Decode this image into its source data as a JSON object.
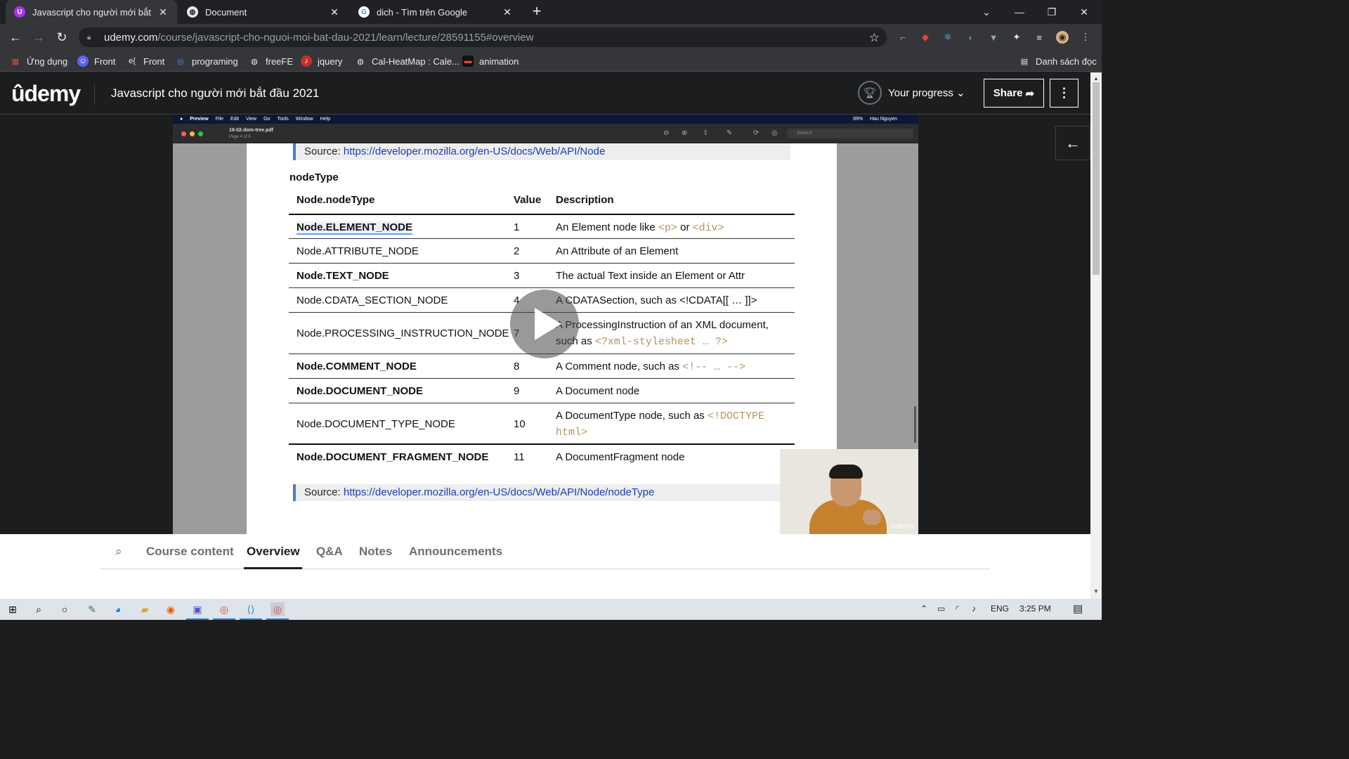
{
  "browser": {
    "tabs": [
      {
        "title": "Javascript cho người mới bắt đầu",
        "favicon_letter": "U",
        "favicon_color": "#a435f0"
      },
      {
        "title": "Document",
        "favicon_letter": "",
        "favicon_color": "#e8eaed"
      },
      {
        "title": "dich - Tìm trên Google",
        "favicon_letter": "G",
        "favicon_color": "#ffffff"
      }
    ],
    "url_host": "udemy.com",
    "url_path": "/course/javascript-cho-nguoi-moi-bat-dau-2021/learn/lecture/28591155#overview",
    "bookmarks": [
      {
        "label": "Ứng dụng",
        "icon": "apps-grid-icon"
      },
      {
        "label": "Front",
        "icon": "discord-icon"
      },
      {
        "label": "Front",
        "icon": "code-braces-icon"
      },
      {
        "label": "programing",
        "icon": "q-icon"
      },
      {
        "label": "freeFE",
        "icon": "globe-icon"
      },
      {
        "label": "jquery",
        "icon": "music-icon"
      },
      {
        "label": "Cal-HeatMap : Cale...",
        "icon": "globe-icon"
      },
      {
        "label": "animation",
        "icon": "bar-icon"
      }
    ],
    "reading_list": "Danh sách đọc"
  },
  "udemy": {
    "logo": "ûdemy",
    "course_title": "Javascript cho người mới bắt đầu 2021",
    "progress_label": "Your progress",
    "share_label": "Share"
  },
  "video": {
    "mac_menu": [
      "Preview",
      "File",
      "Edit",
      "View",
      "Go",
      "Tools",
      "Window",
      "Help"
    ],
    "mac_user": "Hau Nguyen",
    "mac_battery": "89%",
    "pdf_name": "19-02-dom-tree.pdf",
    "pdf_page": "Page 4 of 5",
    "pdf_search_placeholder": "Search",
    "source_top_label": "Source: ",
    "source_top_url": "https://developer.mozilla.org/en-US/docs/Web/API/Node",
    "section_title": "nodeType",
    "table": {
      "headers": [
        "Node.nodeType",
        "Value",
        "Description"
      ],
      "rows": [
        {
          "name": "Node.ELEMENT_NODE",
          "value": "1",
          "desc_pre": "An Element node like ",
          "code1": "<p>",
          "desc_mid": " or ",
          "code2": "<div>"
        },
        {
          "name": "Node.ATTRIBUTE_NODE",
          "value": "2",
          "desc": "An Attribute of an Element"
        },
        {
          "name": "Node.TEXT_NODE",
          "value": "3",
          "desc": "The actual Text inside an Element or Attr"
        },
        {
          "name": "Node.CDATA_SECTION_NODE",
          "value": "4",
          "desc": "A CDATASection, such as <!CDATA[[ … ]]>"
        },
        {
          "name": "Node.PROCESSING_INSTRUCTION_NODE",
          "value": "7",
          "desc_line1": "A ProcessingInstruction of an XML document,",
          "desc_line2_pre": "such as ",
          "code": "<?xml-stylesheet … ?>"
        },
        {
          "name": "Node.COMMENT_NODE",
          "value": "8",
          "desc_pre": "A Comment node, such as ",
          "code": "<!-- … -->"
        },
        {
          "name": "Node.DOCUMENT_NODE",
          "value": "9",
          "desc": "A Document node"
        },
        {
          "name": "Node.DOCUMENT_TYPE_NODE",
          "value": "10",
          "desc_pre": "A DocumentType node, such as ",
          "code1": "<!DOCTYPE",
          "code2": "html>"
        },
        {
          "name": "Node.DOCUMENT_FRAGMENT_NODE",
          "value": "11",
          "desc": "A DocumentFragment node"
        }
      ]
    },
    "source_bottom_label": "Source: ",
    "source_bottom_url": "https://developer.mozilla.org/en-US/docs/Web/API/Node/nodeType",
    "webcam_watermark": "ûdemy"
  },
  "course_tabs": [
    "Course content",
    "Overview",
    "Q&A",
    "Notes",
    "Announcements"
  ],
  "active_course_tab": "Overview",
  "taskbar": {
    "lang": "ENG",
    "time": "3:25 PM"
  },
  "colors": {
    "udemy_dark": "#1c1d1f",
    "link_blue": "#1a3cb8",
    "code_tan": "#b8925a",
    "source_bar_blue": "#4b7dc4"
  }
}
